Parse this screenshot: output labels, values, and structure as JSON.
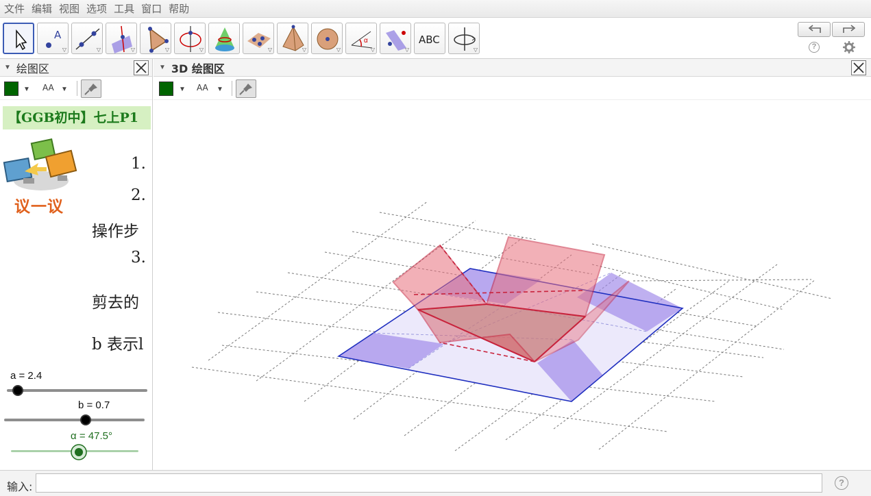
{
  "menu": [
    "文件",
    "编辑",
    "视图",
    "选项",
    "工具",
    "窗口",
    "帮助"
  ],
  "toolbar": {
    "tools": [
      "move-tool",
      "point-tool",
      "line-tool",
      "perpendicular-line-tool",
      "polygon-tool",
      "circle-axis-tool",
      "intersect-surfaces-tool",
      "plane-tool",
      "pyramid-tool",
      "sphere-tool",
      "angle-tool",
      "reflect-tool",
      "text-tool",
      "rotate-view-tool"
    ],
    "text_tool_label": "ABC",
    "help_glyph": "?"
  },
  "left_panel": {
    "title": "绘图区",
    "style_bar": {
      "color": "#006400",
      "aa": "AA"
    },
    "banner": "【GGB初中】七上P1",
    "discuss_label": "议一议",
    "lines": [
      "1.",
      "2.",
      "操作步",
      "3.",
      "剪去的",
      "b 表示l"
    ],
    "sliders": [
      {
        "label": "a = 2.4",
        "value": 2.4
      },
      {
        "label": "b = 0.7",
        "value": 0.7
      },
      {
        "label": "α = 47.5°",
        "value": 47.5
      }
    ]
  },
  "view3d": {
    "title": "3D 绘图区",
    "style_bar": {
      "color": "#006400",
      "aa": "AA"
    }
  },
  "input_bar": {
    "label": "输入:",
    "value": "",
    "help": "?"
  },
  "colors": {
    "base_edge": "#1f2fbf",
    "cut_square": "#9d85e8",
    "fold_fill": "#e8707e",
    "fold_edge": "#c8233c",
    "slider_alpha": "#1f6e1f"
  }
}
